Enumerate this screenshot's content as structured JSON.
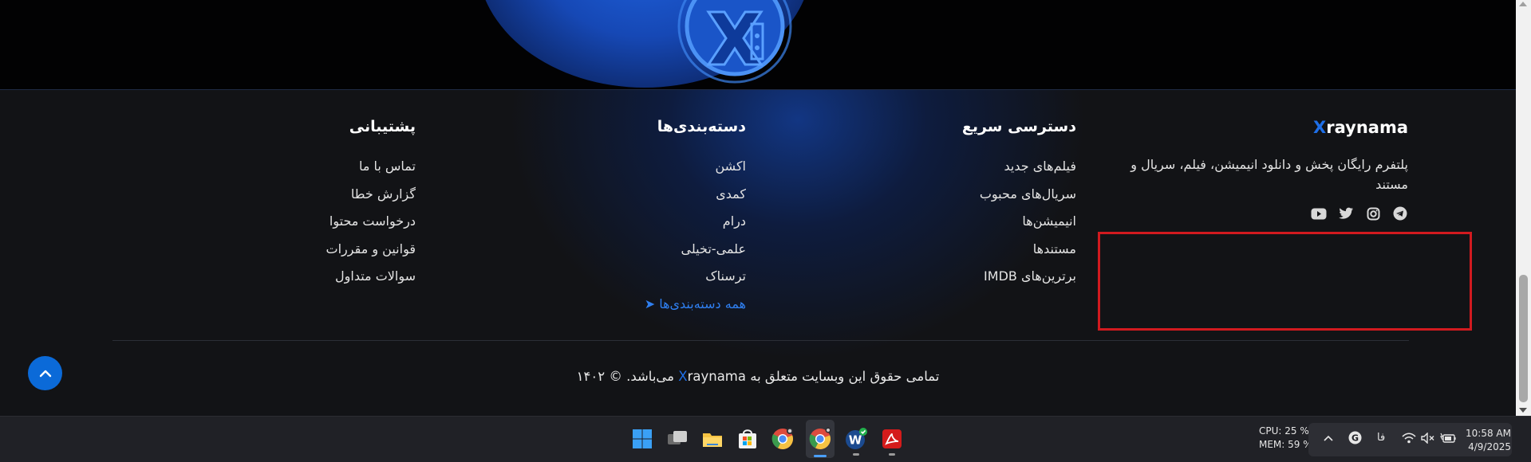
{
  "footer": {
    "brand": {
      "logo_x": "X",
      "logo_rest": "raynama",
      "description": "پلتفرم رایگان پخش و دانلود انیمیشن، فیلم، سریال و مستند",
      "socials": [
        "telegram-icon",
        "instagram-icon",
        "twitter-icon",
        "youtube-icon"
      ]
    },
    "quick_access": {
      "title": "دسترسی سریع",
      "items": [
        "فیلم‌های جدید",
        "سریال‌های محبوب",
        "انیمیشن‌ها",
        "مستندها",
        "برترین‌های IMDB"
      ]
    },
    "categories": {
      "title": "دسته‌بندی‌ها",
      "items": [
        "اکشن",
        "کمدی",
        "درام",
        "علمی-تخیلی",
        "ترسناک"
      ],
      "all_link": "همه دسته‌بندی‌ها ➤"
    },
    "support": {
      "title": "پشتیبانی",
      "items": [
        "تماس با ما",
        "گزارش خطا",
        "درخواست محتوا",
        "قوانین و مقررات",
        "سوالات متداول"
      ]
    },
    "copyright": {
      "before": "تمامی حقوق این وبسایت متعلق به ",
      "brand_x": "X",
      "brand_rest": "raynama",
      "after": " می‌باشد. © ۱۴۰۲"
    }
  },
  "colors": {
    "accent": "#1e6fe8",
    "highlight_box": "#d11a1f",
    "back_to_top": "#0b6ad8"
  },
  "taskbar": {
    "apps": [
      "windows-start-icon",
      "task-view-icon",
      "file-explorer-icon",
      "microsoft-store-icon",
      "chrome-icon",
      "chrome-active-icon",
      "wamp-icon",
      "acrobat-icon"
    ],
    "cpu": "CPU: 25 %",
    "mem": "MEM: 59 %",
    "lang": "فا",
    "time": "10:58 AM",
    "date": "4/9/2025"
  }
}
